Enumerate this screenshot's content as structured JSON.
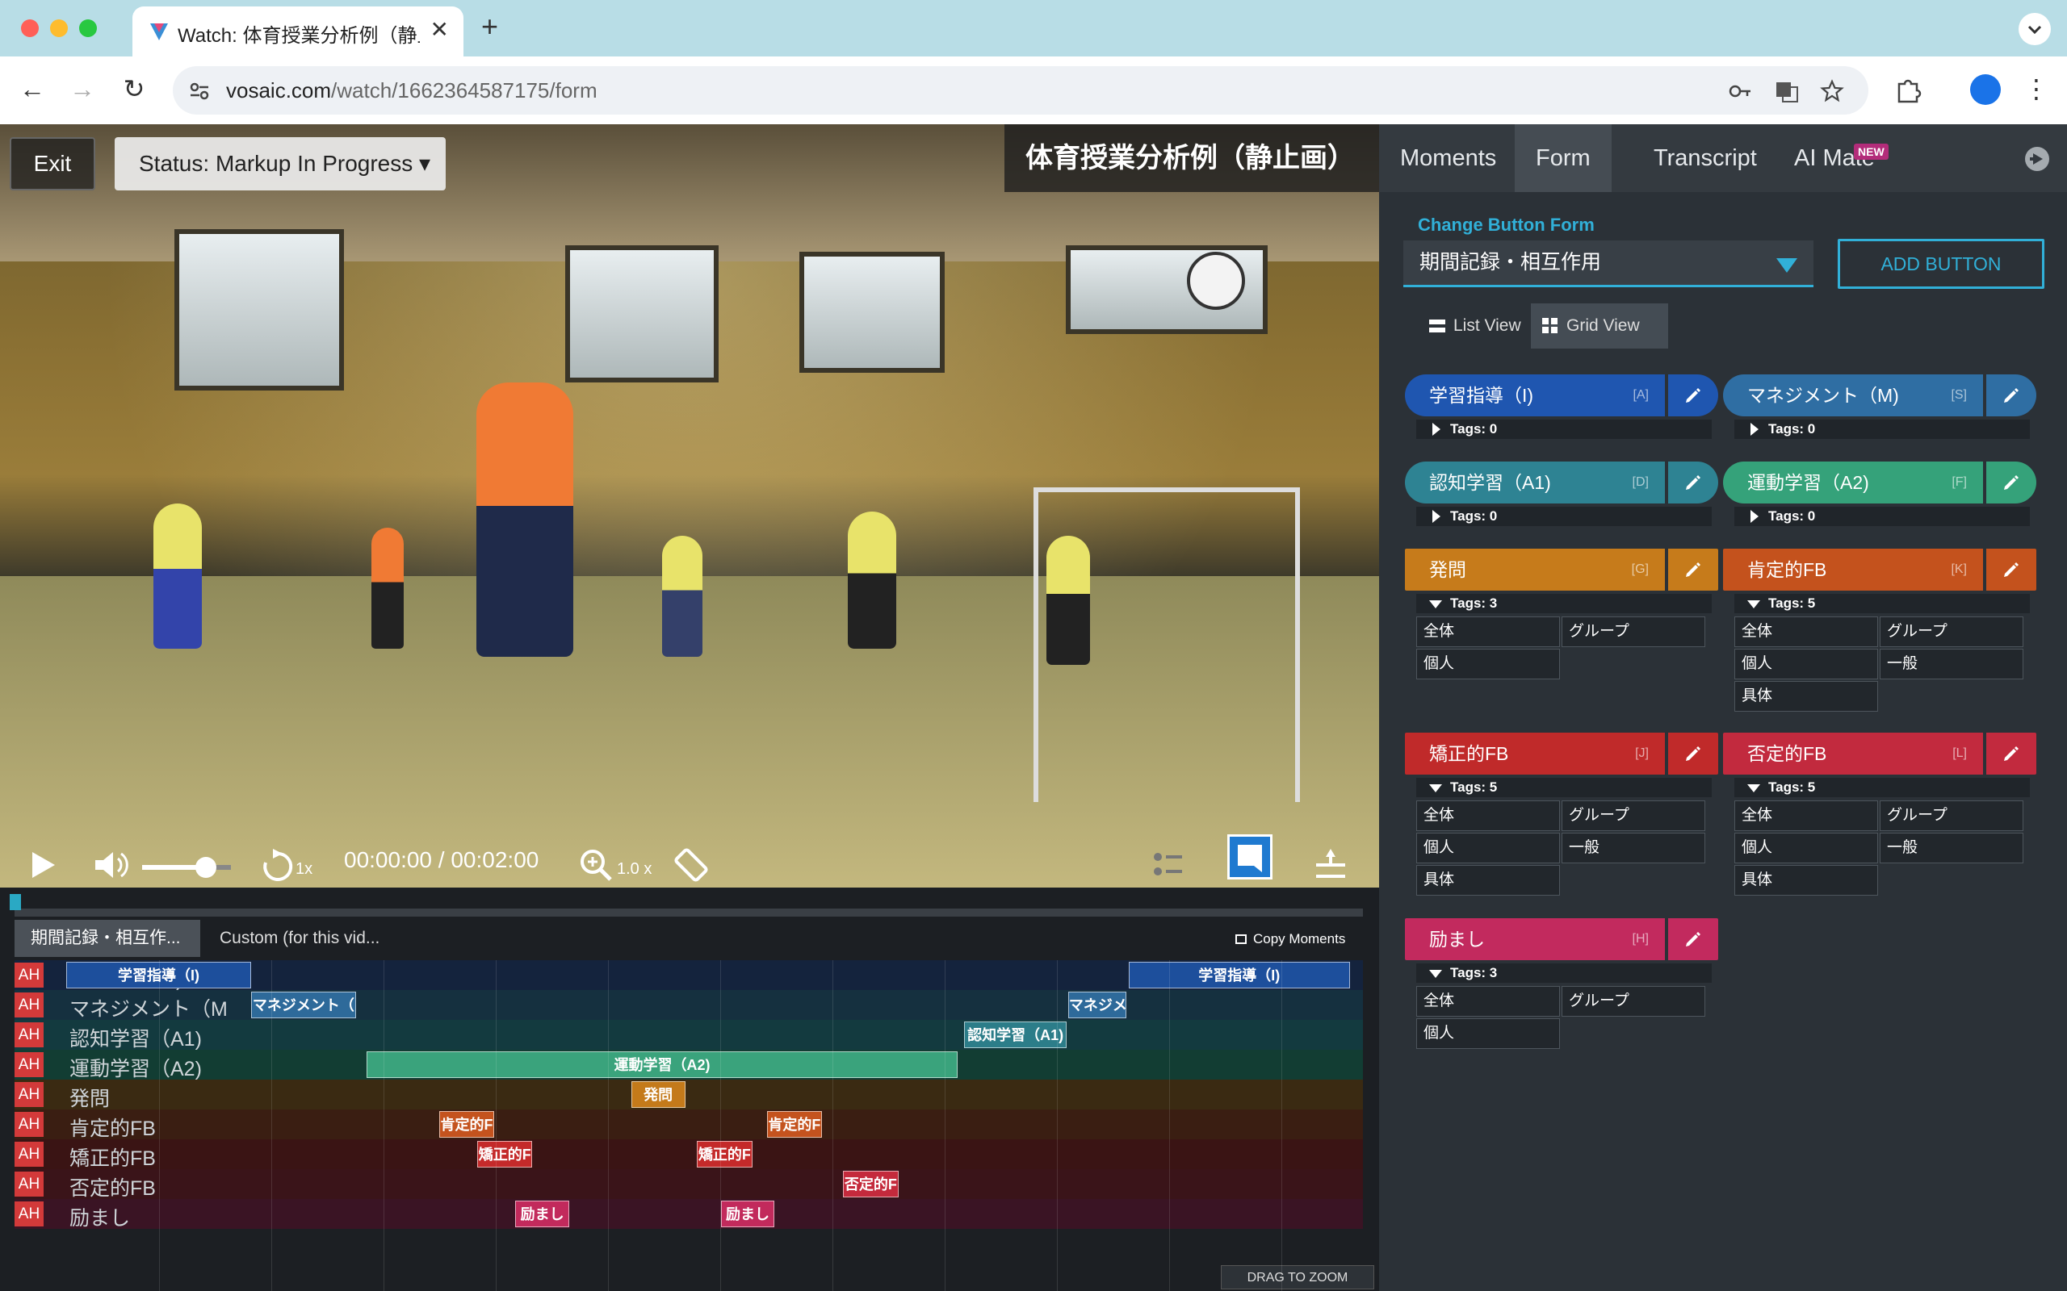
{
  "browser": {
    "tab_title": "Watch: 体育授業分析例（静止画）",
    "url_host": "vosaic.com",
    "url_path": "/watch/1662364587175/form"
  },
  "video": {
    "exit_label": "Exit",
    "status_label": "Status: Markup In Progress ▾",
    "title": "体育授業分析例（静止画）",
    "current_time": "00:00:00",
    "duration": "/ 00:02:00",
    "speed": "1x",
    "zoom": "1.0 x",
    "volume_level": 0.72
  },
  "timeline": {
    "tabs": [
      "期間記録・相互作...",
      "Custom (for this vid..."
    ],
    "copy_moments": "Copy Moments",
    "drag_to_zoom": "DRAG TO ZOOM",
    "ah_label": "AH",
    "rows": [
      {
        "label": "学習指導（I)",
        "color": "#1d4f9c",
        "bg": "#14233d"
      },
      {
        "label": "マネジメント（M",
        "color": "#2e6a9a",
        "bg": "#15303f"
      },
      {
        "label": "認知学習（A1)",
        "color": "#2c7d89",
        "bg": "#133a3f"
      },
      {
        "label": "運動学習（A2)",
        "color": "#3aa37c",
        "bg": "#123d33"
      },
      {
        "label": "発問",
        "color": "#c47a1a",
        "bg": "#3a2a12"
      },
      {
        "label": "肯定的FB",
        "color": "#c4531e",
        "bg": "#3a1e12"
      },
      {
        "label": "矯正的FB",
        "color": "#c42a2a",
        "bg": "#3a1414"
      },
      {
        "label": "否定的FB",
        "color": "#c42a3c",
        "bg": "#3a1419"
      },
      {
        "label": "励まし",
        "color": "#c22a5c",
        "bg": "#3a1424"
      }
    ],
    "segments": [
      {
        "row": 0,
        "text": "学習指導（I)",
        "start": 0.015,
        "end": 0.155
      },
      {
        "row": 0,
        "text": "学習指導（I)",
        "start": 0.822,
        "end": 0.99
      },
      {
        "row": 1,
        "text": "マネジメント（",
        "start": 0.155,
        "end": 0.235
      },
      {
        "row": 1,
        "text": "マネジメ",
        "start": 0.776,
        "end": 0.82
      },
      {
        "row": 2,
        "text": "認知学習（A1)",
        "start": 0.697,
        "end": 0.775
      },
      {
        "row": 3,
        "text": "運動学習（A2)",
        "start": 0.243,
        "end": 0.692
      },
      {
        "row": 4,
        "text": "発問",
        "start": 0.444,
        "end": 0.485
      },
      {
        "row": 5,
        "text": "肯定的F",
        "start": 0.298,
        "end": 0.34
      },
      {
        "row": 5,
        "text": "肯定的F",
        "start": 0.547,
        "end": 0.589
      },
      {
        "row": 6,
        "text": "矯正的F",
        "start": 0.327,
        "end": 0.369
      },
      {
        "row": 6,
        "text": "矯正的F",
        "start": 0.494,
        "end": 0.536
      },
      {
        "row": 7,
        "text": "否定的F",
        "start": 0.605,
        "end": 0.647
      },
      {
        "row": 8,
        "text": "励まし",
        "start": 0.356,
        "end": 0.397
      },
      {
        "row": 8,
        "text": "励まし",
        "start": 0.512,
        "end": 0.553
      }
    ]
  },
  "panel": {
    "tabs": [
      "Moments",
      "Form",
      "Transcript",
      "AI Mate"
    ],
    "new_badge": "NEW",
    "change_button_form": "Change Button Form",
    "form_selected": "期間記録・相互作用",
    "add_button": "ADD BUTTON",
    "list_view": "List View",
    "grid_view": "Grid View",
    "buttons": [
      {
        "label": "学習指導（I)",
        "hotkey": "[A]",
        "color": "#1f56b0",
        "tags_label": "Tags: 0",
        "tags": []
      },
      {
        "label": "マネジメント（M)",
        "hotkey": "[S]",
        "color": "#2f6ea3",
        "tags_label": "Tags: 0",
        "tags": []
      },
      {
        "label": "認知学習（A1)",
        "hotkey": "[D]",
        "color": "#2e8393",
        "tags_label": "Tags: 0",
        "tags": []
      },
      {
        "label": "運動学習（A2)",
        "hotkey": "[F]",
        "color": "#35a27a",
        "tags_label": "Tags: 0",
        "tags": []
      },
      {
        "label": "発問",
        "hotkey": "[G]",
        "color": "#c67b1b",
        "tags_label": "Tags: 3",
        "tags": [
          "全体",
          "グループ",
          "個人"
        ]
      },
      {
        "label": "肯定的FB",
        "hotkey": "[K]",
        "color": "#c4521d",
        "tags_label": "Tags: 5",
        "tags": [
          "全体",
          "グループ",
          "個人",
          "一般",
          "具体"
        ]
      },
      {
        "label": "矯正的FB",
        "hotkey": "[J]",
        "color": "#c02a2a",
        "tags_label": "Tags: 5",
        "tags": [
          "全体",
          "グループ",
          "個人",
          "一般",
          "具体"
        ]
      },
      {
        "label": "否定的FB",
        "hotkey": "[L]",
        "color": "#c22a3e",
        "tags_label": "Tags: 5",
        "tags": [
          "全体",
          "グループ",
          "個人",
          "一般",
          "具体"
        ]
      },
      {
        "label": "励まし",
        "hotkey": "[H]",
        "color": "#c22a5e",
        "tags_label": "Tags: 3",
        "tags": [
          "全体",
          "グループ",
          "個人"
        ]
      }
    ]
  }
}
